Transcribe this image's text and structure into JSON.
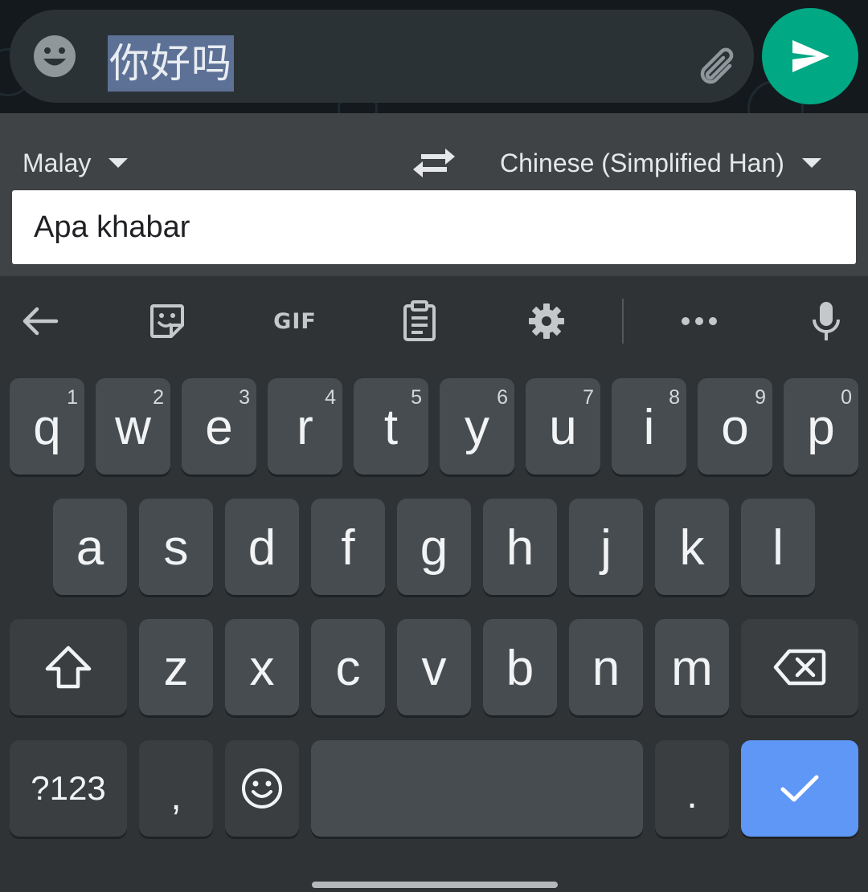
{
  "compose": {
    "message_text": "你好吗",
    "emoji_icon": "emoji-smile-icon",
    "attach_icon": "paperclip-icon",
    "send_icon": "send-arrow-icon"
  },
  "translate": {
    "source_language": "Malay",
    "target_language": "Chinese (Simplified Han)",
    "input_text": "Apa khabar",
    "swap_icon": "swap-arrows-icon"
  },
  "toolbar": {
    "back_icon": "arrow-left-icon",
    "sticker_icon": "sticker-icon",
    "gif_label": "GIF",
    "clipboard_icon": "clipboard-icon",
    "settings_icon": "gear-icon",
    "more_icon": "more-dots-icon",
    "mic_icon": "microphone-icon"
  },
  "keyboard": {
    "row1": [
      {
        "label": "q",
        "hint": "1"
      },
      {
        "label": "w",
        "hint": "2"
      },
      {
        "label": "e",
        "hint": "3"
      },
      {
        "label": "r",
        "hint": "4"
      },
      {
        "label": "t",
        "hint": "5"
      },
      {
        "label": "y",
        "hint": "6"
      },
      {
        "label": "u",
        "hint": "7"
      },
      {
        "label": "i",
        "hint": "8"
      },
      {
        "label": "o",
        "hint": "9"
      },
      {
        "label": "p",
        "hint": "0"
      }
    ],
    "row2": [
      "a",
      "s",
      "d",
      "f",
      "g",
      "h",
      "j",
      "k",
      "l"
    ],
    "row3": [
      "z",
      "x",
      "c",
      "v",
      "b",
      "n",
      "m"
    ],
    "symbols_label": "?123",
    "comma_label": ",",
    "period_label": ".",
    "shift_icon": "shift-arrow-icon",
    "backspace_icon": "backspace-icon",
    "emoji_icon": "emoji-smile-icon",
    "enter_icon": "checkmark-icon"
  },
  "colors": {
    "send_button": "#00a884",
    "enter_key": "#5e97f6",
    "selection_highlight": "#5d7196"
  }
}
